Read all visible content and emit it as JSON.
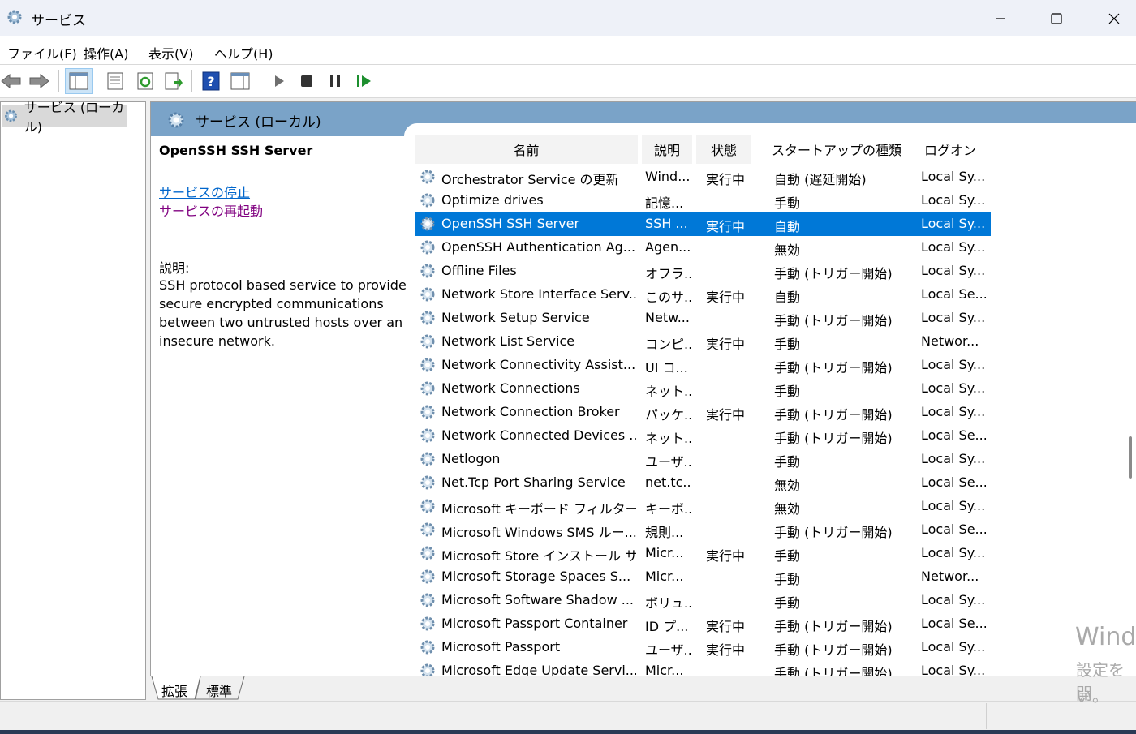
{
  "window": {
    "title": "サービス",
    "controls": [
      "minimize",
      "maximize",
      "close"
    ]
  },
  "menu": [
    "ファイル(F)",
    "操作(A)",
    "表示(V)",
    "ヘルプ(H)"
  ],
  "tree": {
    "root_label": "サービス (ローカル)"
  },
  "main": {
    "header_title": "サービス (ローカル)",
    "selected_service": "OpenSSH SSH Server",
    "links": {
      "stop": "サービスの停止",
      "restart": "サービスの再起動"
    },
    "description_label": "説明:",
    "description": "SSH protocol based service to provide secure encrypted communications between two untrusted hosts over an insecure network."
  },
  "columns": [
    "名前",
    "説明",
    "状態",
    "スタートアップの種類",
    "ログオン"
  ],
  "rows": [
    {
      "name": "Orchestrator Service の更新",
      "desc": "Wind...",
      "status": "実行中",
      "startup": "自動 (遅延開始)",
      "logon": "Local Sy..."
    },
    {
      "name": "Optimize drives",
      "desc": "記憶...",
      "status": "",
      "startup": "手動",
      "logon": "Local Sy..."
    },
    {
      "name": "OpenSSH SSH Server",
      "desc": "SSH ...",
      "status": "実行中",
      "startup": "自動",
      "logon": "Local Sy..."
    },
    {
      "name": "OpenSSH Authentication Ag...",
      "desc": "Agen...",
      "status": "",
      "startup": "無効",
      "logon": "Local Sy..."
    },
    {
      "name": "Offline Files",
      "desc": "オフラ...",
      "status": "",
      "startup": "手動 (トリガー開始)",
      "logon": "Local Sy..."
    },
    {
      "name": "Network Store Interface Serv...",
      "desc": "このサ...",
      "status": "実行中",
      "startup": "自動",
      "logon": "Local Se..."
    },
    {
      "name": "Network Setup Service",
      "desc": "Netw...",
      "status": "",
      "startup": "手動 (トリガー開始)",
      "logon": "Local Sy..."
    },
    {
      "name": "Network List Service",
      "desc": "コンピ...",
      "status": "実行中",
      "startup": "手動",
      "logon": "Networ..."
    },
    {
      "name": "Network Connectivity Assist...",
      "desc": "UI コ...",
      "status": "",
      "startup": "手動 (トリガー開始)",
      "logon": "Local Sy..."
    },
    {
      "name": "Network Connections",
      "desc": "ネット...",
      "status": "",
      "startup": "手動",
      "logon": "Local Sy..."
    },
    {
      "name": "Network Connection Broker",
      "desc": "パッケ...",
      "status": "実行中",
      "startup": "手動 (トリガー開始)",
      "logon": "Local Sy..."
    },
    {
      "name": "Network Connected Devices ...",
      "desc": "ネット...",
      "status": "",
      "startup": "手動 (トリガー開始)",
      "logon": "Local Se..."
    },
    {
      "name": "Netlogon",
      "desc": "ユーザ...",
      "status": "",
      "startup": "手動",
      "logon": "Local Sy..."
    },
    {
      "name": "Net.Tcp Port Sharing Service",
      "desc": "net.tc...",
      "status": "",
      "startup": "無効",
      "logon": "Local Se..."
    },
    {
      "name": "Microsoft キーボード フィルター",
      "desc": "キーボ...",
      "status": "",
      "startup": "無効",
      "logon": "Local Sy..."
    },
    {
      "name": "Microsoft Windows SMS ルー...",
      "desc": "規則...",
      "status": "",
      "startup": "手動 (トリガー開始)",
      "logon": "Local Se..."
    },
    {
      "name": "Microsoft Store インストール サ...",
      "desc": "Micr...",
      "status": "実行中",
      "startup": "手動",
      "logon": "Local Sy..."
    },
    {
      "name": "Microsoft Storage Spaces S...",
      "desc": "Micr...",
      "status": "",
      "startup": "手動",
      "logon": "Networ..."
    },
    {
      "name": "Microsoft Software Shadow ...",
      "desc": "ボリュ...",
      "status": "",
      "startup": "手動",
      "logon": "Local Sy..."
    },
    {
      "name": "Microsoft Passport Container",
      "desc": "ID プ...",
      "status": "実行中",
      "startup": "手動 (トリガー開始)",
      "logon": "Local Se..."
    },
    {
      "name": "Microsoft Passport",
      "desc": "ユーザ...",
      "status": "実行中",
      "startup": "手動 (トリガー開始)",
      "logon": "Local Sy..."
    },
    {
      "name": "Microsoft Edge Update Servi...",
      "desc": "Micr...",
      "status": "",
      "startup": "手動 (トリガー開始)",
      "logon": "Local Sy..."
    }
  ],
  "selected_row_index": 2,
  "bottom_tabs": [
    "拡張",
    "標準"
  ],
  "watermark": [
    "Wind",
    "設定を開",
    "い。"
  ],
  "colors": {
    "selection": "#0078d7",
    "header": "#7aa3c8",
    "link_blue": "#0066cc",
    "link_visited": "#800080"
  }
}
